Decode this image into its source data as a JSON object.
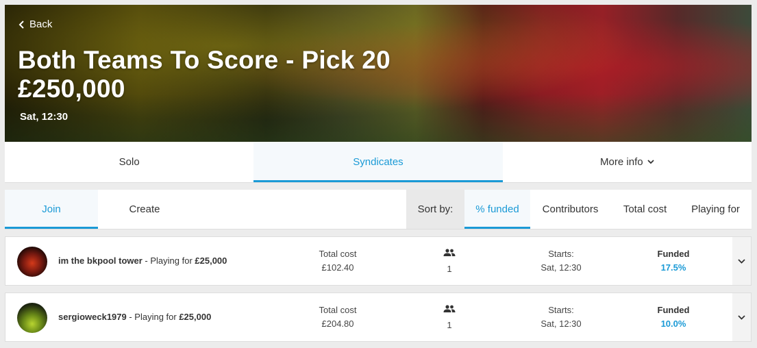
{
  "hero": {
    "back_label": "Back",
    "title_line1": "Both Teams To Score - Pick 20",
    "title_line2": "£250,000",
    "time": "Sat, 12:30"
  },
  "mode_tabs": [
    {
      "label": "Solo",
      "active": false
    },
    {
      "label": "Syndicates",
      "active": true
    },
    {
      "label": "More info",
      "active": false
    }
  ],
  "sub_tabs": {
    "join": "Join",
    "create": "Create",
    "sort_by": "Sort by:",
    "sort_options": [
      "% funded",
      "Contributors",
      "Total cost",
      "Playing for"
    ],
    "active_sort": "% funded"
  },
  "syndicates": [
    {
      "name": "im the bkpool tower",
      "playing_for_text": " - Playing for ",
      "playing_for": "£25,000",
      "total_cost_label": "Total cost",
      "total_cost": "£102.40",
      "contributors": "1",
      "starts_label": "Starts:",
      "starts": "Sat, 12:30",
      "funded_label": "Funded",
      "funded": "17.5%"
    },
    {
      "name": "sergioweck1979",
      "playing_for_text": " - Playing for ",
      "playing_for": "£25,000",
      "total_cost_label": "Total cost",
      "total_cost": "£204.80",
      "contributors": "1",
      "starts_label": "Starts:",
      "starts": "Sat, 12:30",
      "funded_label": "Funded",
      "funded": "10.0%"
    }
  ],
  "colors": {
    "accent": "#1a9ad6",
    "hero_red": "#a02229",
    "hero_yellow": "#d8c21e"
  }
}
